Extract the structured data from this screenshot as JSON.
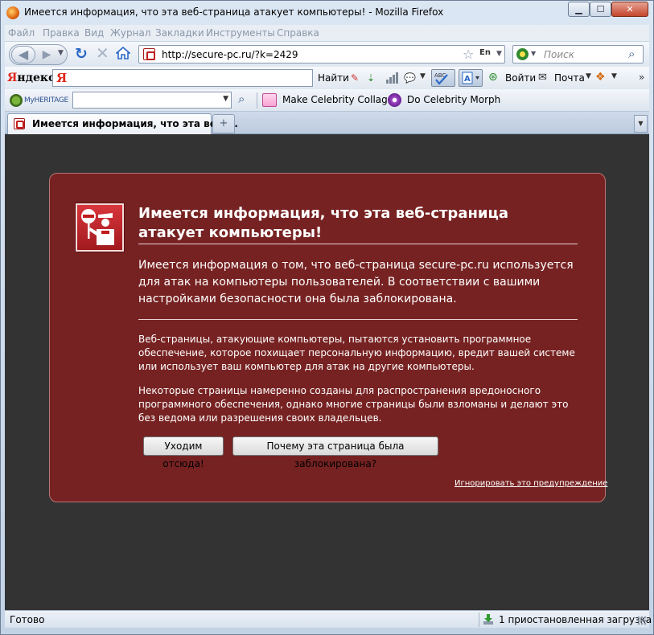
{
  "window": {
    "title": "Имеется информация, что эта веб-страница атакует компьютеры! - Mozilla Firefox",
    "minimize_glyph": "▁",
    "maximize_glyph": "☐",
    "close_glyph": "✕"
  },
  "menubar": {
    "items": [
      "Файл",
      "Правка",
      "Вид",
      "Журнал",
      "Закладки",
      "Инструменты",
      "Справка"
    ]
  },
  "navbar": {
    "url": "http://secure-pc.ru/?k=2429",
    "lang_badge": "En",
    "search_placeholder": "Поиск"
  },
  "yandex_bar": {
    "logo_ya": "Я",
    "logo_rest": "ндекс",
    "input_icon": "Я",
    "find_label": "Найти",
    "login_label": "Войти",
    "mail_label": "Почта"
  },
  "heritage_bar": {
    "logo_text": "MyHERITAGE",
    "collage_label": "Make Celebrity Collage",
    "morph_label": "Do Celebrity Morph"
  },
  "tabs": {
    "active_label": "Имеется информация, что эта веб-...",
    "new_tab_glyph": "+",
    "list_glyph": "▼"
  },
  "warning": {
    "title": "Имеется информация, что эта веб-страница атакует компьютеры!",
    "intro": "Имеется информация о том, что веб-страница secure-pc.ru используется для атак на компьютеры пользователей. В соответствии с вашими настройками безопасности она была заблокирована.",
    "para1": "Веб-страницы, атакующие компьютеры, пытаются установить программное обеспечение, которое похищает персональную информацию, вредит вашей системе или использует ваш компьютер для атак на другие компьютеры.",
    "para2": "Некоторые страницы намеренно созданы для распространения вредоносного программного обеспечения, однако многие страницы были взломаны и делают это без ведома или разрешения своих владельцев.",
    "getout_button": "Уходим отсюда!",
    "why_button": "Почему эта страница была заблокирована?",
    "ignore_link": "Игнорировать это предупреждение"
  },
  "statusbar": {
    "status": "Готово",
    "downloads": "1 приостановленная загрузка"
  },
  "colors": {
    "warning_bg": "#772222",
    "content_bg": "#333333",
    "brand_red": "#e0261b"
  },
  "icons": [
    "firefox-icon",
    "back-icon",
    "forward-icon",
    "reload-icon",
    "stop-icon",
    "home-icon",
    "bookmark-star-icon",
    "search-icon",
    "yandex-logo",
    "shield-officer-icon",
    "download-icon"
  ]
}
